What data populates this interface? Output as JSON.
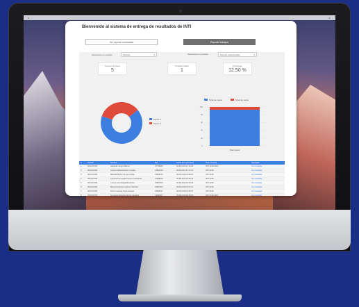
{
  "app": {
    "welcome": "Bienvenido al sistema de entrega de resultados de INTI"
  },
  "tabs": [
    {
      "label": "Ver reporte conductas"
    },
    {
      "label": "Reporte trabajos"
    }
  ],
  "filters": {
    "left_label": "Seleccione un periodo",
    "left_value": "Periodo",
    "right_label": "Seleccione un periodo",
    "right_value": "Periodo seleccionado"
  },
  "stats": [
    {
      "label": "Numero de casos",
      "value": "5"
    },
    {
      "label": "Pruebas totales",
      "value": "1"
    },
    {
      "label": "Porcentaje",
      "value": "12,50 %"
    }
  ],
  "donut": {
    "legend": [
      "Series 1",
      "Series 2"
    ],
    "colors": [
      "#3d7fe0",
      "#e04a3a"
    ],
    "fractions": [
      0.66,
      0.34
    ]
  },
  "bar": {
    "legend": [
      "Total de casos",
      "Total de casos"
    ],
    "colors": [
      "#3d7fe0",
      "#e04a3a"
    ],
    "yticks": [
      "100",
      "80",
      "60",
      "40",
      "20",
      "0"
    ],
    "xlabel": "Total casos"
  },
  "table": {
    "headers": [
      "#",
      "Periodo",
      "Nombre",
      "Rut",
      "Fecha de la encuesta",
      "Tipo encuesta",
      "Resultado"
    ],
    "rows": [
      [
        "1",
        "2019-09708",
        "Alejandro Sergio Muñoz",
        "17718480",
        "20-08-2019 17:19:04",
        "INTI 2018-2019",
        "Ver resultado"
      ],
      [
        "2",
        "2019-09708",
        "Antonio Mella Martínez Cuadra",
        "14804218",
        "20-08-2019 17:00:16",
        "INTI 2018",
        "Ver resultado"
      ],
      [
        "3",
        "2019-09708",
        "Marcela Muñoz de Hermosilla",
        "13868276",
        "20-08-2019 16:58:03",
        "INTI 2018",
        "Ver resultado"
      ],
      [
        "4",
        "2019-09708",
        "Leonardo Fernando Fonseca Cárdenas",
        "17668070",
        "20-08-2019 16:55:42",
        "INTI 2018",
        "Ver resultado"
      ],
      [
        "5",
        "2019-09708",
        "Laura Luisa Zúñiga Barrientos",
        "15887403",
        "20-08-2019 16:53:28",
        "INTI 2018",
        "Ver resultado"
      ],
      [
        "6",
        "2019-09708",
        "Manuel Francisco Gómez Sánchez",
        "15867604",
        "20-08-2019 16:51:52",
        "INTI 2018",
        "Ver resultado"
      ],
      [
        "7",
        "2019-09708",
        "Rocío Carolina Vega Andrade",
        "16829117",
        "20-08-2019 16:48:37",
        "INTI 2018",
        "Ver resultado"
      ],
      [
        "8",
        "2019-09708",
        "Fernanda Alejandra Rozas Santana",
        "14026407",
        "20-08-2019 16:46:00",
        "INTI 2018-2019",
        "Ver resultado"
      ]
    ]
  }
}
